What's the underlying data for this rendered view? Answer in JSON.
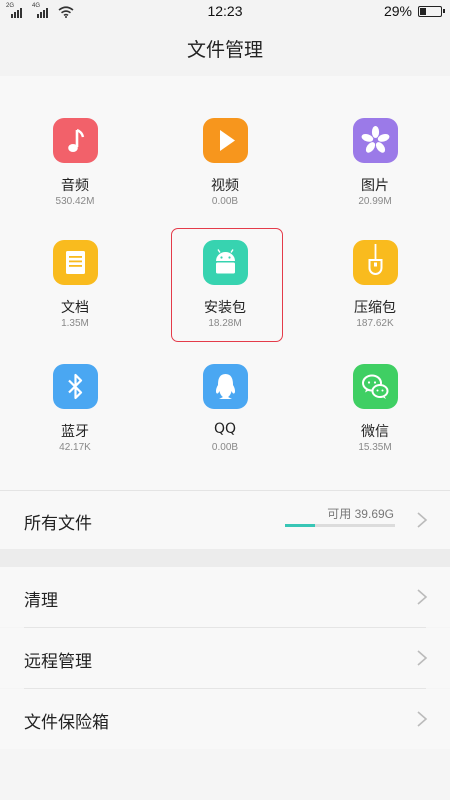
{
  "status_bar": {
    "sim1_tag": "2G",
    "sim2_tag": "4G",
    "time": "12:23",
    "battery_percent": "29%",
    "battery_level": 0.29,
    "icons": [
      "signal-icon",
      "signal-icon",
      "wifi-icon",
      "battery-icon"
    ]
  },
  "header": {
    "title": "文件管理"
  },
  "categories": [
    {
      "label": "音频",
      "size": "530.42M",
      "icon": "music-note-icon",
      "color": "#f2616a"
    },
    {
      "label": "视频",
      "size": "0.00B",
      "icon": "play-icon",
      "color": "#f7961d"
    },
    {
      "label": "图片",
      "size": "20.99M",
      "icon": "flower-icon",
      "color": "#9b7ae8"
    },
    {
      "label": "文档",
      "size": "1.35M",
      "icon": "document-icon",
      "color": "#f9bb1e"
    },
    {
      "label": "安装包",
      "size": "18.28M",
      "icon": "android-icon",
      "color": "#37d3b0"
    },
    {
      "label": "压缩包",
      "size": "187.62K",
      "icon": "zip-icon",
      "color": "#f9bb1e"
    },
    {
      "label": "蓝牙",
      "size": "42.17K",
      "icon": "bluetooth-icon",
      "color": "#4aa7f2"
    },
    {
      "label": "QQ",
      "size": "0.00B",
      "icon": "qq-icon",
      "color": "#4aa7f2"
    },
    {
      "label": "微信",
      "size": "15.35M",
      "icon": "wechat-icon",
      "color": "#3fcf63"
    }
  ],
  "all_files": {
    "label": "所有文件",
    "available": "可用 39.69G",
    "used_fraction": 0.27
  },
  "menu": [
    {
      "label": "清理"
    },
    {
      "label": "远程管理"
    },
    {
      "label": "文件保险箱"
    }
  ],
  "colors": {
    "accent": "#38c6b6",
    "highlight_border": "#e43b4a"
  }
}
